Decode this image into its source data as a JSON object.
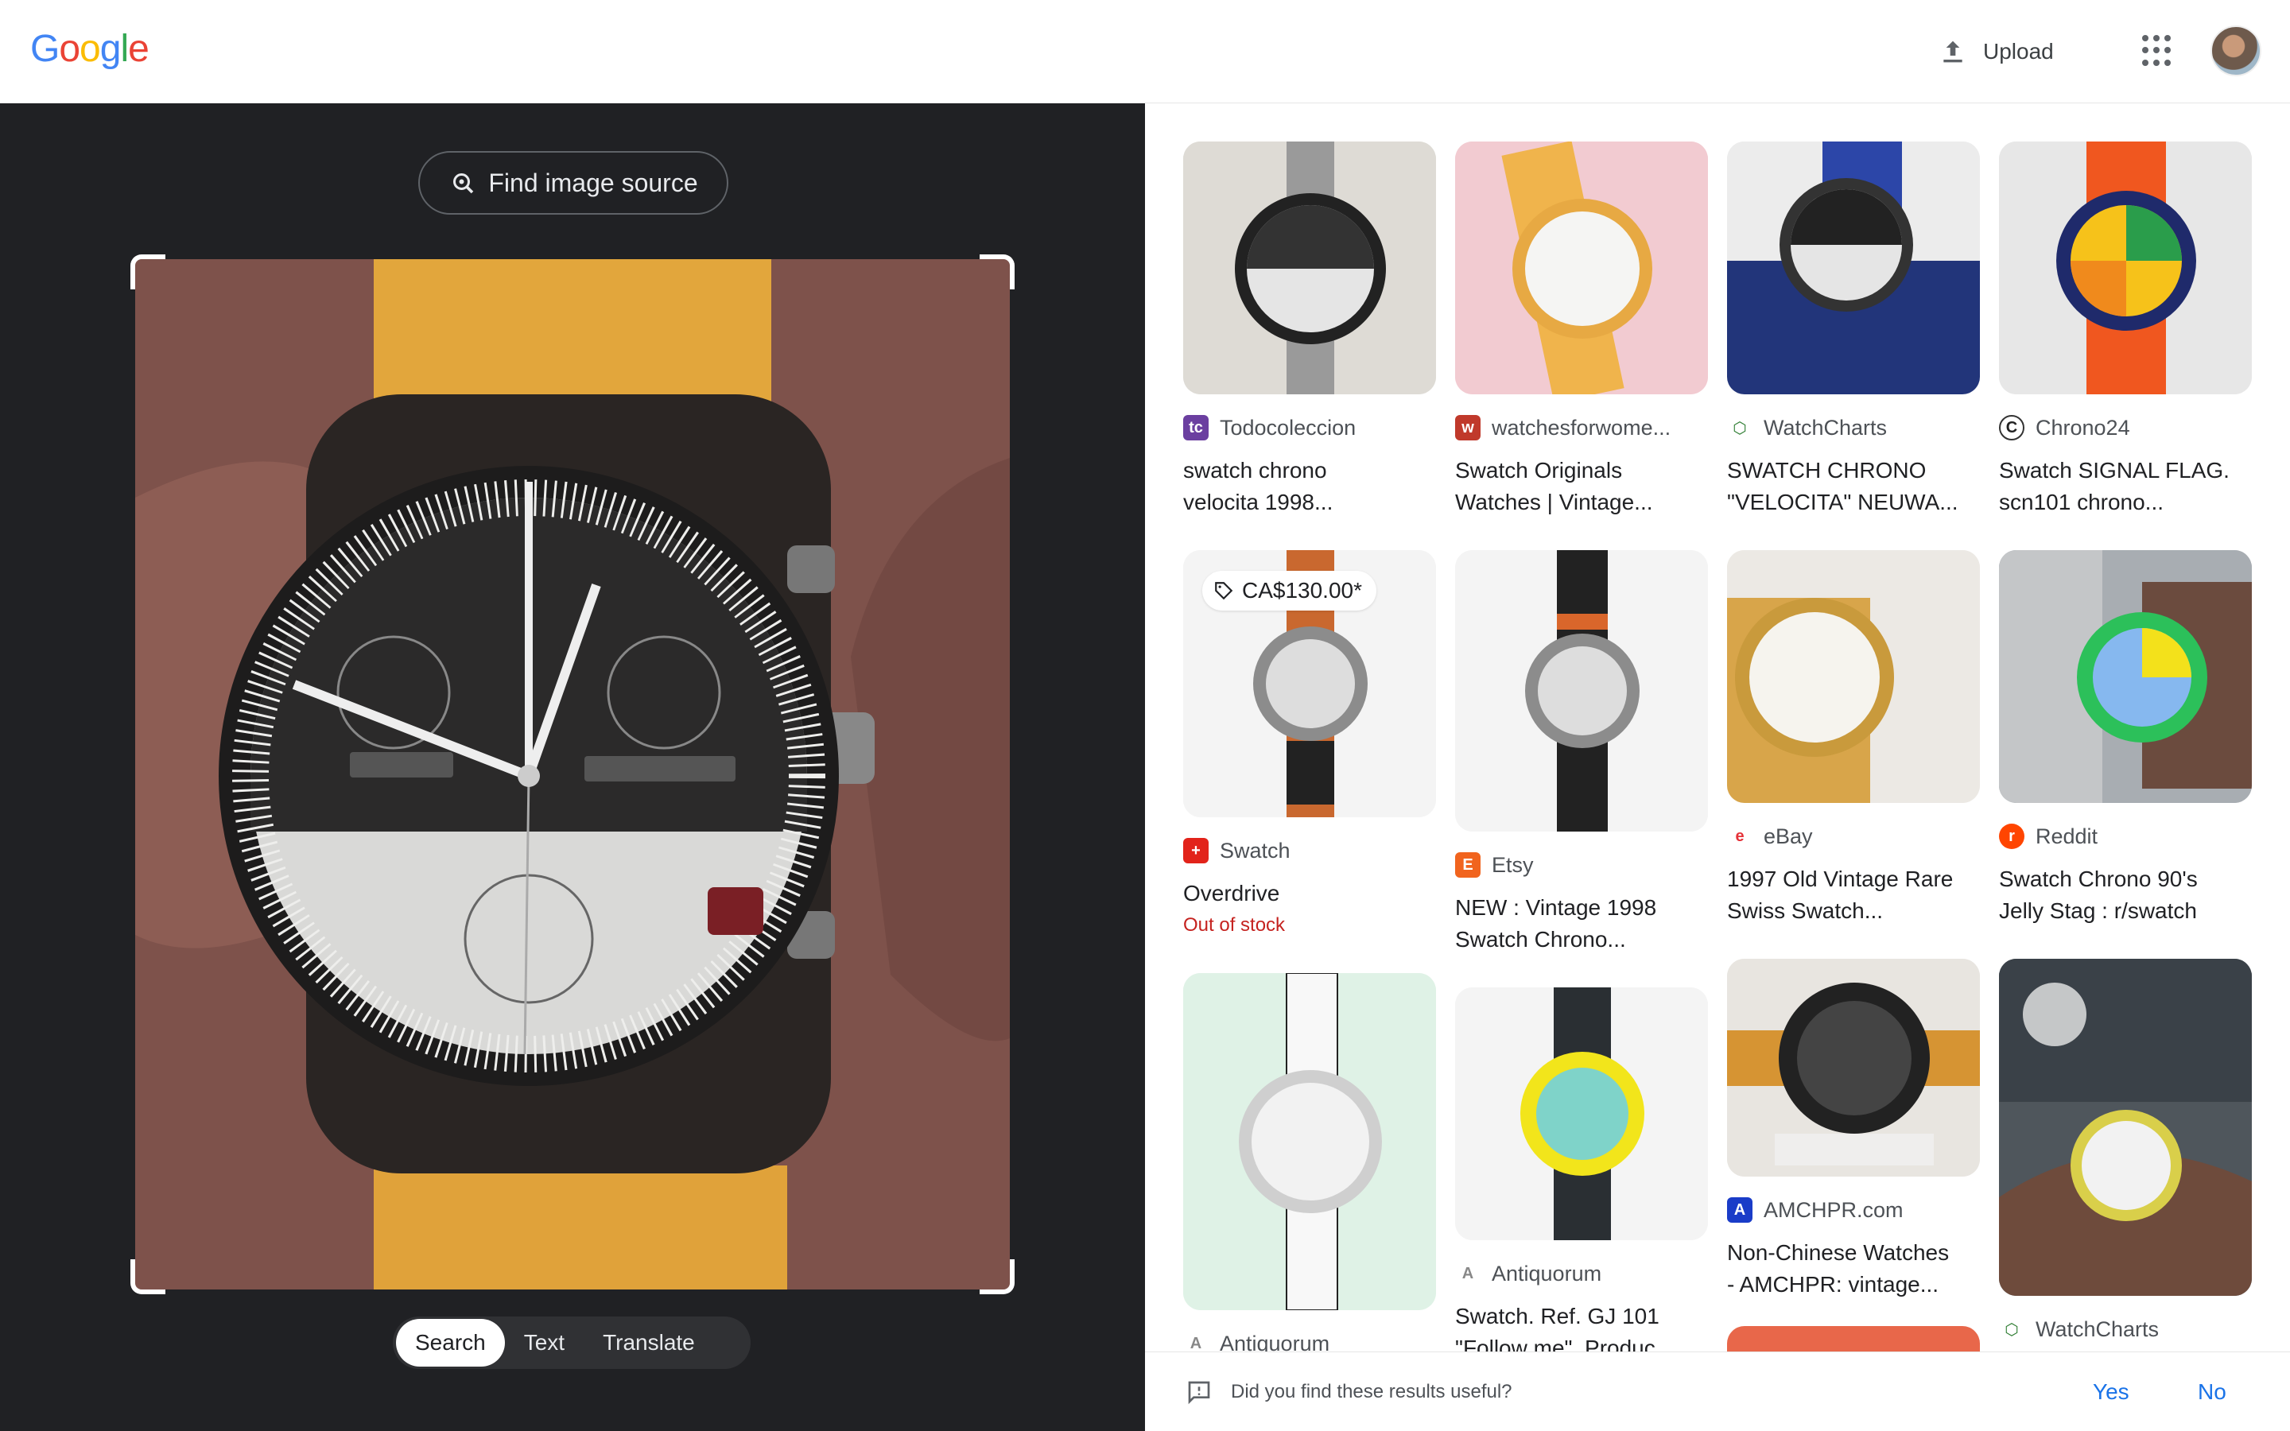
{
  "header": {
    "logo": "Google",
    "upload_label": "Upload"
  },
  "left": {
    "find_source_label": "Find image source",
    "modes": [
      "Search",
      "Text",
      "Translate"
    ],
    "active_mode": "Search"
  },
  "results": [
    {
      "source": "Todocoleccion",
      "title1": "swatch chrono",
      "title2": "velocita 1998...",
      "fav_color": "#6b3fa0",
      "fav_char": "tc"
    },
    {
      "source": "watchesforwome...",
      "title1": "Swatch Originals",
      "title2": "Watches | Vintage...",
      "fav_color": "#c0392b",
      "fav_char": "w"
    },
    {
      "source": "WatchCharts",
      "title1": "SWATCH CHRONO",
      "title2": "\"VELOCITA\" NEUWA...",
      "fav_color": "#2e7d32",
      "fav_char": "⬡"
    },
    {
      "source": "Chrono24",
      "title1": "Swatch SIGNAL FLAG.",
      "title2": "scn101 chrono...",
      "fav_color": "#ffffff",
      "fav_char": "C"
    },
    {
      "source": "Swatch",
      "title1": "Overdrive",
      "title2": "",
      "price": "CA$130.00*",
      "stock": "Out of stock",
      "fav_color": "#e2231a",
      "fav_char": "+"
    },
    {
      "source": "Etsy",
      "title1": "NEW : Vintage 1998",
      "title2": "Swatch Chrono...",
      "fav_color": "#f1641e",
      "fav_char": "E"
    },
    {
      "source": "eBay",
      "title1": "1997 Old Vintage Rare",
      "title2": "Swiss Swatch...",
      "fav_color": "#ffffff",
      "fav_char": "e"
    },
    {
      "source": "Reddit",
      "title1": "Swatch Chrono 90's",
      "title2": "Jelly Stag : r/swatch",
      "fav_color": "#ff4500",
      "fav_char": "r"
    },
    {
      "source": "Antiquorum",
      "title1": "",
      "title2": "",
      "fav_color": "#ffffff",
      "fav_char": "A"
    },
    {
      "source": "Antiquorum",
      "title1": "Swatch. Ref. GJ 101",
      "title2": "\"Follow me\", Produc...",
      "fav_color": "#ffffff",
      "fav_char": "A"
    },
    {
      "source": "AMCHPR.com",
      "title1": "Non-Chinese Watches",
      "title2": "- AMCHPR: vintage...",
      "fav_color": "#1a3cc8",
      "fav_char": "A"
    },
    {
      "source": "WatchCharts",
      "title1": "",
      "title2": "",
      "fav_color": "#2e7d32",
      "fav_char": "⬡"
    }
  ],
  "feedback": {
    "question": "Did you find these results useful?",
    "yes": "Yes",
    "no": "No"
  },
  "colors": {
    "accent": "#1a73e8",
    "dark_panel": "#202124",
    "strap_yellow": "#e0a23a"
  }
}
